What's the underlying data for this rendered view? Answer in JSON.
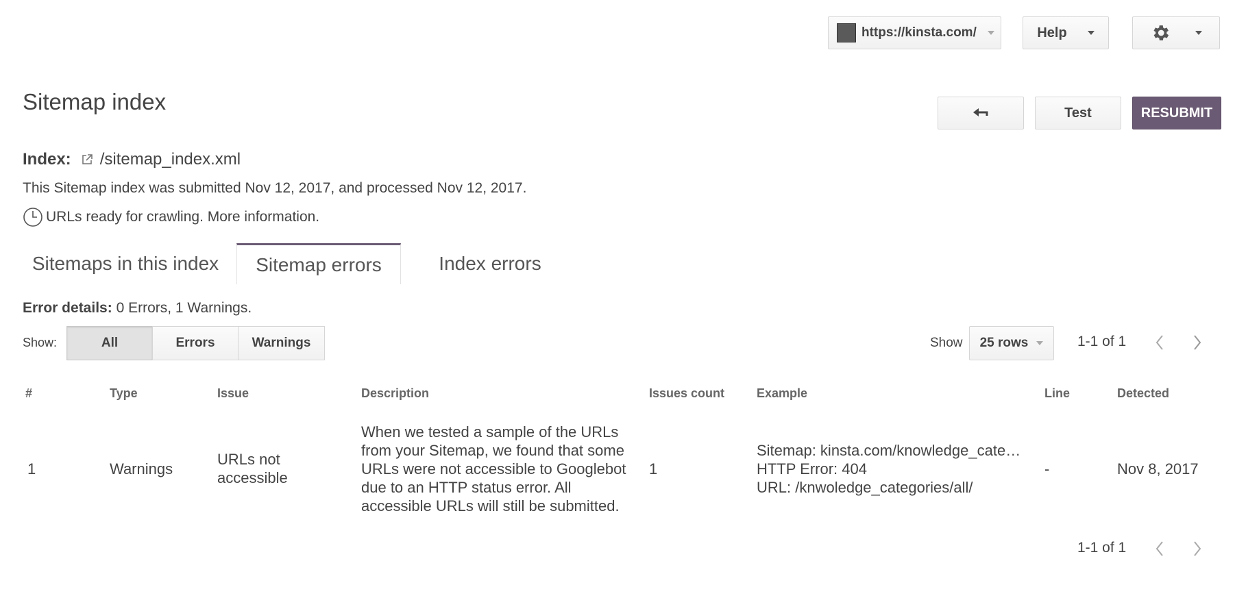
{
  "header": {
    "site": "https://kinsta.com/",
    "help": "Help"
  },
  "page": {
    "title": "Sitemap index",
    "test": "Test",
    "resubmit": "RESUBMIT",
    "index_label": "Index:",
    "index_path": "/sitemap_index.xml",
    "submitted_text": "This Sitemap index was submitted Nov 12, 2017, and processed Nov 12, 2017.",
    "ready_text": "URLs ready for crawling. More information."
  },
  "tabs": [
    {
      "label": "Sitemaps in this index",
      "active": false
    },
    {
      "label": "Sitemap errors",
      "active": true
    },
    {
      "label": "Index errors",
      "active": false
    }
  ],
  "error_details": {
    "label": "Error details:",
    "summary": "0 Errors, 1 Warnings."
  },
  "filter": {
    "show_label": "Show:",
    "options": [
      "All",
      "Errors",
      "Warnings"
    ],
    "selected": "All"
  },
  "pagination": {
    "show_label": "Show",
    "rows": "25 rows",
    "range_top": "1-1 of 1",
    "range_bottom": "1-1 of 1"
  },
  "table": {
    "columns": [
      "#",
      "Type",
      "Issue",
      "Description",
      "Issues count",
      "Example",
      "Line",
      "Detected"
    ],
    "rows": [
      {
        "num": "1",
        "type": "Warnings",
        "issue_l1": "URLs not",
        "issue_l2": "accessible",
        "desc_l1": "When we tested a sample of the URLs",
        "desc_l2": "from your Sitemap, we found that some",
        "desc_l3": "URLs were not accessible to Googlebot",
        "desc_l4": "due to an HTTP status error. All",
        "desc_l5": "accessible URLs will still be submitted.",
        "count": "1",
        "ex_l1": "Sitemap: kinsta.com/knowledge_cate…",
        "ex_l2": "HTTP Error: 404",
        "ex_l3": "URL: /knwoledge_categories/all/",
        "line": "-",
        "detected": "Nov 8, 2017"
      }
    ]
  },
  "icons": {
    "site_favicon": "site-favicon-icon",
    "settings": "gear-icon",
    "back": "back-arrow-icon",
    "external_link": "external-link-icon",
    "clock": "clock-icon",
    "prev": "chevron-left-icon",
    "next": "chevron-right-icon"
  },
  "colors": {
    "accent": "#6b5a73",
    "text": "#444444"
  }
}
